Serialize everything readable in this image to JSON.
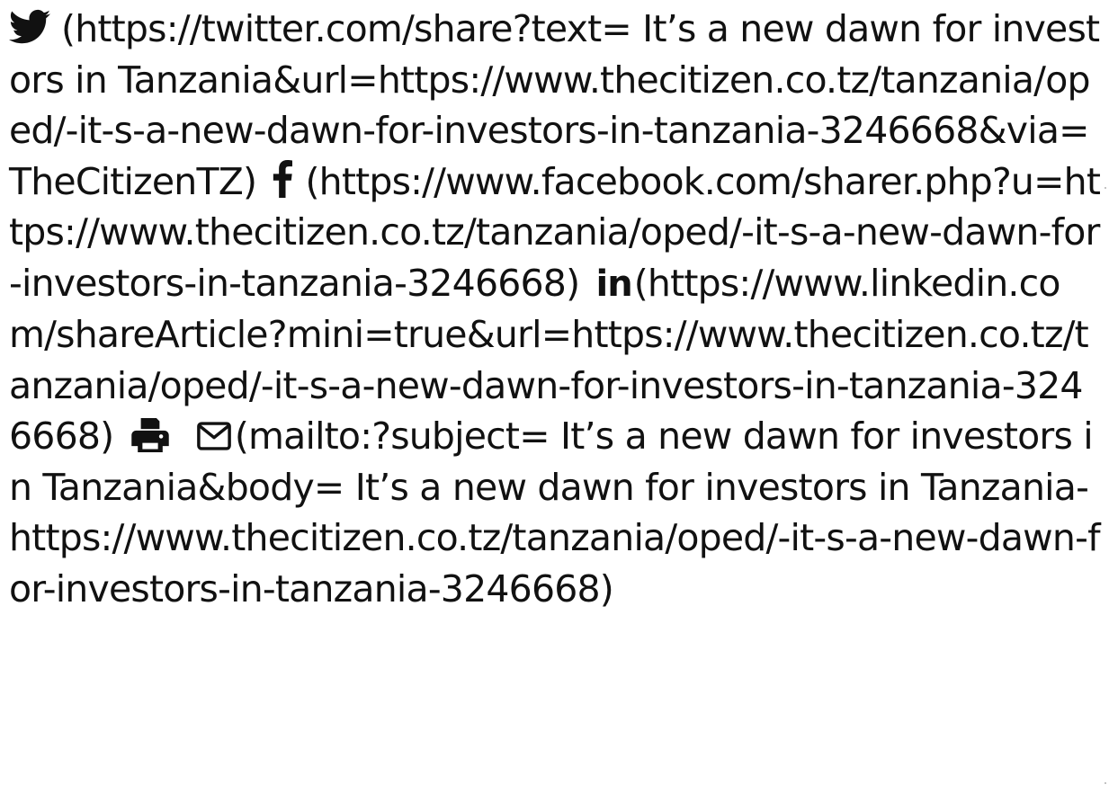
{
  "share": {
    "twitter": {
      "icon": "twitter-icon",
      "text": "(https://twitter.com/share?text= It’s a new dawn for investors in Tanzania&url=https://www.thecitizen.co.tz/tanzania/oped/-it-s-a-new-dawn-for-investors-in-tanzania-3246668&via=TheCitizenTZ)"
    },
    "facebook": {
      "icon": "facebook-icon",
      "text": "(https://www.facebook.com/sharer.php?u=https://www.thecitizen.co.tz/tanzania/oped/-it-s-a-new-dawn-for-investors-in-tanzania-3246668)"
    },
    "linkedin": {
      "icon": "linkedin-icon",
      "glyph": "in",
      "text": "(https://www.linkedin.com/shareArticle?mini=true&url=https://www.thecitizen.co.tz/tanzania/oped/-it-s-a-new-dawn-for-investors-in-tanzania-3246668)"
    },
    "print": {
      "icon": "print-icon"
    },
    "email": {
      "icon": "mail-icon",
      "text": "(mailto:?subject= It’s a new dawn for investors in Tanzania&body= It’s a new dawn for investors in Tanzania-https://www.thecitizen.co.tz/tanzania/oped/-it-s-a-new-dawn-for-investors-in-tanzania-3246668)"
    }
  },
  "colors": {
    "text": "#111111",
    "background": "#ffffff"
  }
}
